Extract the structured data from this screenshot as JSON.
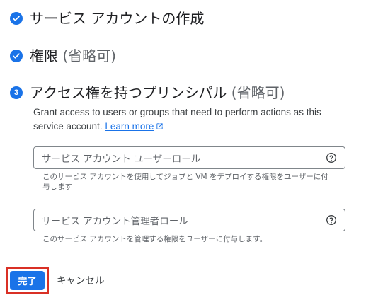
{
  "steps": [
    {
      "status": "completed",
      "icon": "check-icon",
      "title": "サービス アカウントの作成",
      "optional": ""
    },
    {
      "status": "completed",
      "icon": "check-icon",
      "title": "権限",
      "optional": "(省略可)"
    },
    {
      "status": "active",
      "number": "3",
      "title": "アクセス権を持つプリンシパル",
      "optional": "(省略可)"
    }
  ],
  "description": {
    "text": "Grant access to users or groups that need to perform actions as this service account.",
    "learn_more": "Learn more",
    "link_icon": "open-in-new-icon"
  },
  "fields": [
    {
      "placeholder": "サービス アカウント ユーザーロール",
      "hint": "このサービス アカウントを使用してジョブと VM をデプロイする権限をユーザーに付与します",
      "icon": "help-icon"
    },
    {
      "placeholder": "サービス アカウント管理者ロール",
      "hint": "このサービス アカウントを管理する権限をユーザーに付与します。",
      "icon": "help-icon"
    }
  ],
  "actions": {
    "done_label": "完了",
    "cancel_label": "キャンセル"
  },
  "colors": {
    "accent": "#1a73e8",
    "highlight": "#d93025"
  }
}
